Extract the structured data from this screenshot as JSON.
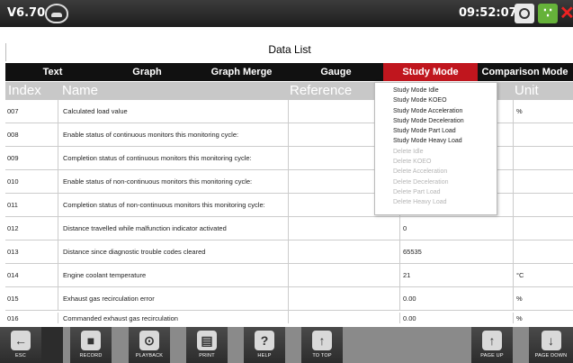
{
  "topbar": {
    "version": "V6.70",
    "time": "09:52:07"
  },
  "title": "Data List",
  "tabs": [
    {
      "label": "Text"
    },
    {
      "label": "Graph"
    },
    {
      "label": "Graph Merge"
    },
    {
      "label": "Gauge"
    },
    {
      "label": "Study Mode"
    },
    {
      "label": "Comparison Mode"
    }
  ],
  "columns": {
    "index": "Index",
    "name": "Name",
    "reference": "Reference",
    "unit": "Unit"
  },
  "rows": [
    {
      "index": "007",
      "name": "Calculated load value",
      "value": "",
      "unit": "%"
    },
    {
      "index": "008",
      "name": "Enable status of continuous monitors this monitoring cycle:",
      "value": "",
      "unit": ""
    },
    {
      "index": "009",
      "name": "Completion status of continuous monitors this monitoring cycle:",
      "value": "",
      "unit": ""
    },
    {
      "index": "010",
      "name": "Enable status of non-continuous monitors this monitoring cycle:",
      "value": "",
      "unit": ""
    },
    {
      "index": "011",
      "name": "Completion status of non-continuous monitors this monitoring cycle:",
      "value": "",
      "unit": ""
    },
    {
      "index": "012",
      "name": "Distance travelled while malfunction indicator activated",
      "value": "0",
      "unit": ""
    },
    {
      "index": "013",
      "name": "Distance since diagnostic trouble codes cleared",
      "value": "65535",
      "unit": ""
    },
    {
      "index": "014",
      "name": "Engine coolant temperature",
      "value": "21",
      "unit": "°C"
    },
    {
      "index": "015",
      "name": "Exhaust gas recirculation error",
      "value": "0.00",
      "unit": "%"
    },
    {
      "index": "016",
      "name": "Commanded exhaust gas recirculation",
      "value": "0.00",
      "unit": "%"
    }
  ],
  "dropdown": {
    "items": [
      {
        "label": "Study Mode Idle"
      },
      {
        "label": "Study Mode KOEO"
      },
      {
        "label": "Study Mode Acceleration"
      },
      {
        "label": "Study Mode Deceleration"
      },
      {
        "label": "Study Mode Part Load"
      },
      {
        "label": "Study Mode Heavy Load"
      },
      {
        "label": "Delete Idle"
      },
      {
        "label": "Delete KOEO"
      },
      {
        "label": "Delete Acceleration"
      },
      {
        "label": "Delete Deceleration"
      },
      {
        "label": "Delete Part Load"
      },
      {
        "label": "Delete Heavy Load"
      }
    ]
  },
  "toolbar": {
    "esc": "ESC",
    "record": "RECORD",
    "playback": "PLAYBACK",
    "print": "PRINT",
    "help": "HELP",
    "to_top": "TO TOP",
    "page_up": "PAGE UP",
    "page_down": "PAGE DOWN"
  },
  "colors": {
    "active_tab": "#c0161e",
    "tab_bar": "#111111",
    "header_row": "#c8c8c8",
    "link_icon": "#66b23a",
    "close_icon": "#e22222"
  }
}
